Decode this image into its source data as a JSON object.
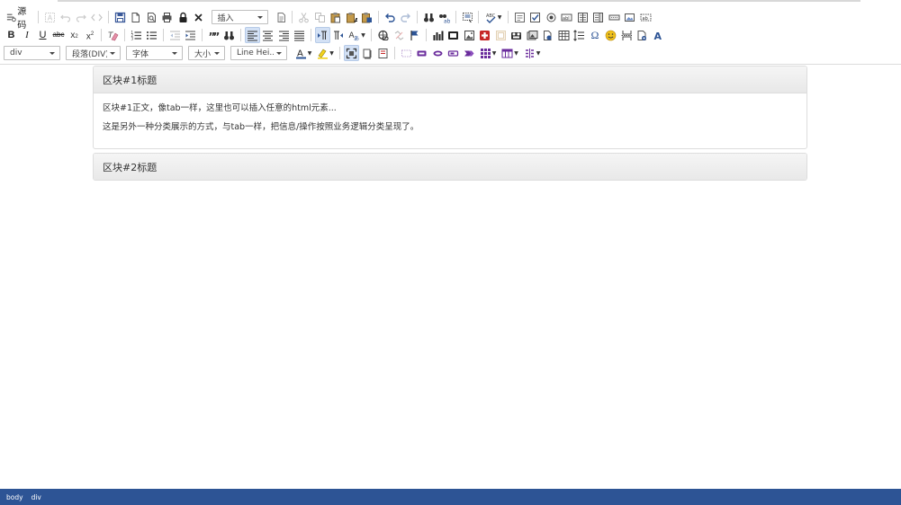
{
  "toolbar": {
    "source_label": "源码",
    "insert_label": "插入",
    "format_label": "div",
    "paragraph_label": "段落(DIV)",
    "font_label": "字体",
    "size_label": "大小",
    "line_height_label": "Line Hei..."
  },
  "panels": [
    {
      "title": "区块#1标题",
      "lines": [
        "区块#1正文，像tab一样，这里也可以插入任意的html元素...",
        "这是另外一种分类展示的方式，与tab一样，把信息/操作按照业务逻辑分类呈现了。"
      ]
    },
    {
      "title": "区块#2标题"
    }
  ],
  "statusbar": {
    "path": [
      "body",
      "div"
    ]
  },
  "colors": {
    "statusbar_bg": "#2d5495",
    "active_button_bg": "#d3e1f5",
    "icon_blue": "#2d5495",
    "icon_red": "#c62828",
    "icon_purple": "#6a2c9c"
  }
}
